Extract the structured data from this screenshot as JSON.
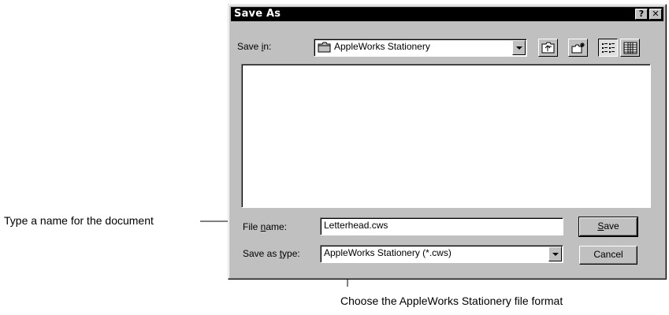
{
  "dialog": {
    "title": "Save As",
    "help_btn": "?",
    "close_btn": "✕",
    "save_in": {
      "label_pre": "Save ",
      "label_ul": "i",
      "label_post": "n:",
      "value": "AppleWorks Stationery",
      "icon": "folder-icon"
    },
    "toolbar": {
      "up_icon": "up-one-level-icon",
      "new_folder_icon": "new-folder-icon",
      "list_icon": "list-view-icon",
      "details_icon": "details-view-icon"
    },
    "file_name": {
      "label_pre": "File ",
      "label_ul": "n",
      "label_post": "ame:",
      "value": "Letterhead.cws"
    },
    "save_as_type": {
      "label_pre": "Save as ",
      "label_ul": "t",
      "label_post": "ype:",
      "value": "AppleWorks Stationery (*.cws)"
    },
    "save_button": {
      "ul": "S",
      "rest": "ave"
    },
    "cancel_button": "Cancel"
  },
  "annotations": {
    "name_hint": "Type a name for the document",
    "type_hint": "Choose the AppleWorks Stationery file format"
  },
  "colors": {
    "dialog_face": "#c0c0c0",
    "titlebar": "#000000"
  }
}
